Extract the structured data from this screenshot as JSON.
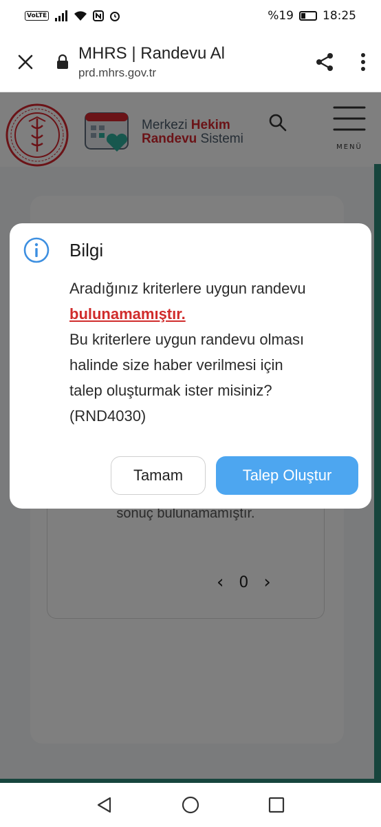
{
  "status_bar": {
    "volte": "VoLTE",
    "battery_percent": "%19",
    "time": "18:25"
  },
  "browser": {
    "title": "MHRS | Randevu Al",
    "url": "prd.mhrs.gov.tr"
  },
  "header": {
    "logo_line1_a": "Merkezi ",
    "logo_line1_b": "Hekim",
    "logo_line2_a": "Randevu",
    "logo_line2_b": " Sistemi",
    "menu_label": "MENÜ"
  },
  "page": {
    "no_result_text": "sonuç bulunamamıştır.",
    "page_number": "0"
  },
  "modal": {
    "title": "Bilgi",
    "body_line1": "Aradığınız kriterlere uygun randevu",
    "body_warning": "bulunamamıştır.",
    "body_line3": "Bu kriterlere uygun randevu olması",
    "body_line4": "halinde size haber verilmesi için",
    "body_line5": "talep oluşturmak ister misiniz?",
    "body_code": "(RND4030)",
    "cancel_label": "Tamam",
    "confirm_label": "Talep Oluştur"
  },
  "colors": {
    "primary_button": "#4da6f0",
    "warning_text": "#d02b2b",
    "accent_teal": "#2e8b7a",
    "info_icon": "#3d8fe0"
  },
  "icons": {
    "close": "close-icon",
    "lock": "lock-icon",
    "share": "share-icon",
    "more": "more-vert-icon",
    "search": "search-icon",
    "menu": "hamburger-menu-icon",
    "info": "info-icon",
    "back": "nav-back-icon",
    "home": "nav-home-icon",
    "recents": "nav-recents-icon"
  }
}
